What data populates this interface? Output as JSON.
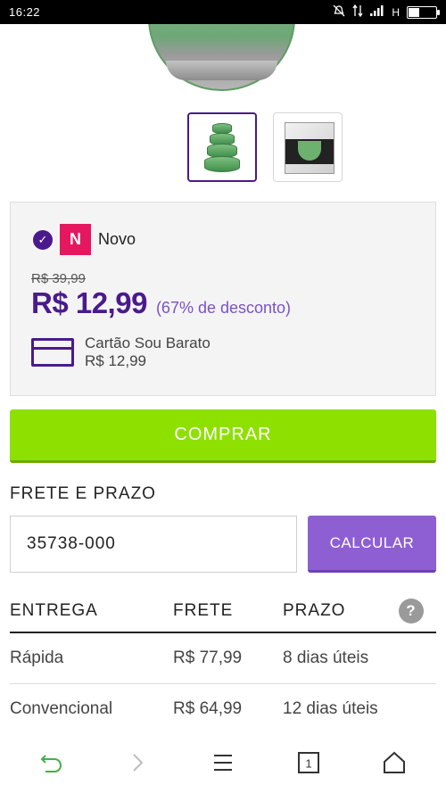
{
  "statusbar": {
    "time": "16:22",
    "network": "H"
  },
  "product": {
    "thumbnails": [
      {
        "alt": "bowls-stack-photo"
      },
      {
        "alt": "bowls-package-photo"
      }
    ]
  },
  "offer": {
    "condition": "Novo",
    "condition_badge": "N",
    "old_price": "R$ 39,99",
    "price": "R$ 12,99",
    "discount": "(67% de desconto)",
    "card_name": "Cartão Sou Barato",
    "card_price": "R$ 12,99"
  },
  "buy_label": "COMPRAR",
  "shipping": {
    "title": "FRETE E PRAZO",
    "cep_value": "35738-000",
    "calc_label": "CALCULAR",
    "headers": {
      "entrega": "ENTREGA",
      "frete": "FRETE",
      "prazo": "PRAZO",
      "help": "?"
    },
    "rows": [
      {
        "entrega": "Rápida",
        "frete": "R$ 77,99",
        "prazo": "8 dias úteis"
      },
      {
        "entrega": "Convencional",
        "frete": "R$ 64,99",
        "prazo": "12 dias úteis"
      }
    ]
  },
  "nav": {
    "tab_count": "1",
    "accent": "#4a1a8c",
    "buy_color": "#8ee000",
    "calc_color": "#8e5fd3"
  }
}
